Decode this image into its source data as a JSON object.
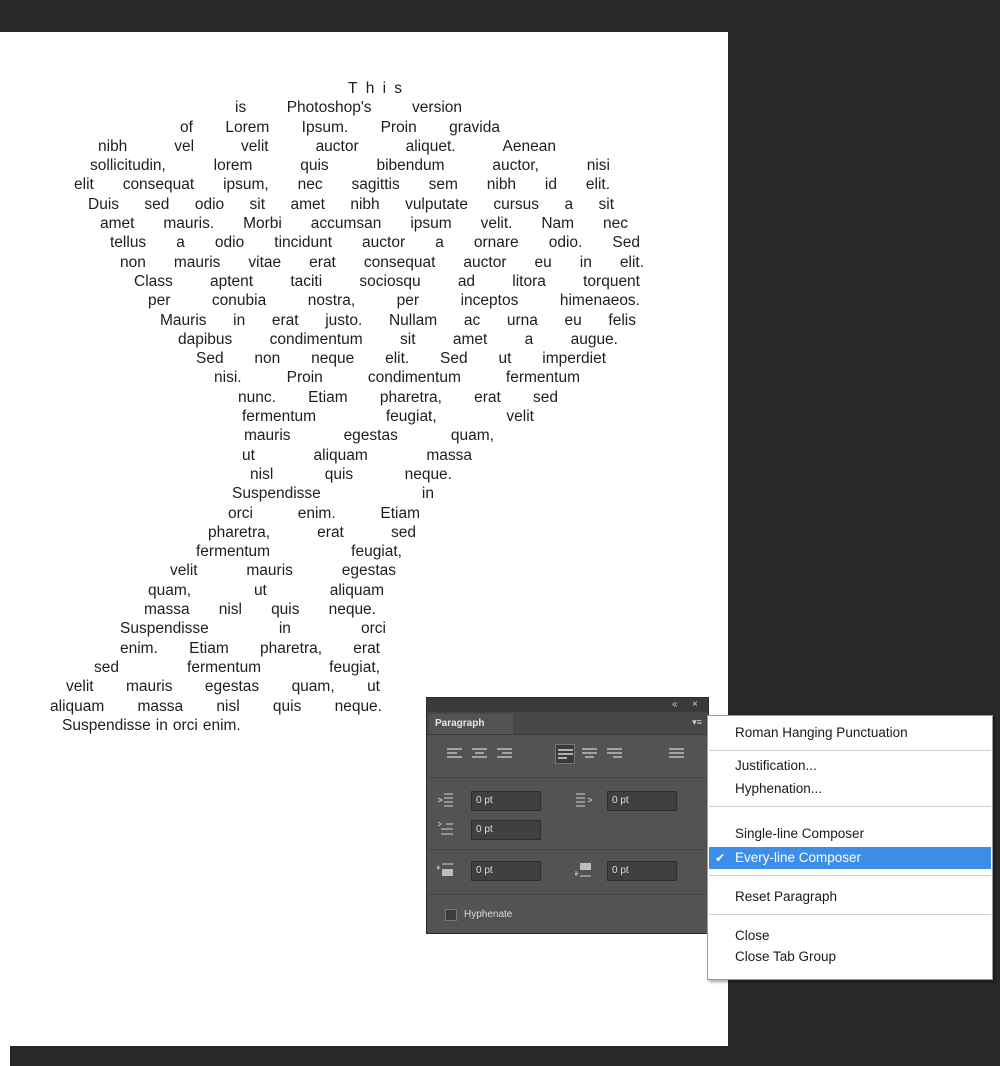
{
  "document": {
    "lines": [
      "This",
      "is Photoshop's version",
      "of Lorem Ipsum. Proin gravida",
      "nibh vel velit auctor aliquet. Aenean",
      "sollicitudin, lorem quis bibendum auctor, nisi",
      "elit consequat ipsum, nec sagittis sem nibh id elit.",
      "Duis sed odio sit amet nibh vulputate cursus a sit",
      "amet mauris. Morbi accumsan ipsum velit. Nam nec",
      "tellus a odio tincidunt auctor a ornare odio. Sed",
      "non mauris vitae erat consequat auctor eu in elit.",
      "Class aptent taciti sociosqu ad litora torquent",
      "per conubia nostra, per inceptos himenaeos.",
      "Mauris in erat justo. Nullam ac urna eu felis",
      "dapibus condimentum sit amet a augue.",
      "Sed non neque elit. Sed ut imperdiet",
      "nisi. Proin condimentum fermentum",
      "nunc. Etiam pharetra, erat sed",
      "fermentum feugiat, velit",
      "mauris egestas quam,",
      "ut aliquam massa",
      "nisl quis neque.",
      "Suspendisse in",
      "orci enim. Etiam",
      "pharetra, erat sed",
      "fermentum feugiat,",
      "velit mauris egestas",
      "quam, ut aliquam",
      "massa nisl quis neque.",
      "Suspendisse in orci",
      "enim. Etiam pharetra, erat",
      "sed fermentum feugiat,",
      "velit mauris egestas quam, ut",
      "aliquam massa nisl quis neque.",
      "Suspendisse in orci enim."
    ]
  },
  "paragraph_panel": {
    "tab_label": "Paragraph",
    "collapse_icon": "double-chevron-icon",
    "close_icon": "close-icon",
    "menu_icon": "panel-menu-icon",
    "alignment_buttons": [
      "align-left",
      "align-center",
      "align-right",
      "justify-last-left",
      "justify-last-center",
      "justify-last-right",
      "justify-all"
    ],
    "active_alignment": "justify-last-left",
    "left_indent": "0 pt",
    "right_indent": "0 pt",
    "first_line_indent": "0 pt",
    "space_before": "0 pt",
    "space_after": "0 pt",
    "hyphenate_label": "Hyphenate",
    "hyphenate_checked": false
  },
  "flyout_menu": {
    "items": [
      {
        "label": "Roman Hanging Punctuation",
        "checked": false,
        "selected": false
      },
      {
        "label": "Justification...",
        "checked": false,
        "selected": false
      },
      {
        "label": "Hyphenation...",
        "checked": false,
        "selected": false
      },
      {
        "label": "Single-line Composer",
        "checked": false,
        "selected": false
      },
      {
        "label": "Every-line Composer",
        "checked": true,
        "selected": true
      },
      {
        "label": "Reset Paragraph",
        "checked": false,
        "selected": false
      },
      {
        "label": "Close",
        "checked": false,
        "selected": false
      },
      {
        "label": "Close Tab Group",
        "checked": false,
        "selected": false
      }
    ],
    "check_glyph": "✔",
    "highlight_color": "#3d8ee8"
  },
  "colors": {
    "pasteboard": "#282828",
    "panel_bg": "#535353",
    "text": "#1e1e1e"
  }
}
